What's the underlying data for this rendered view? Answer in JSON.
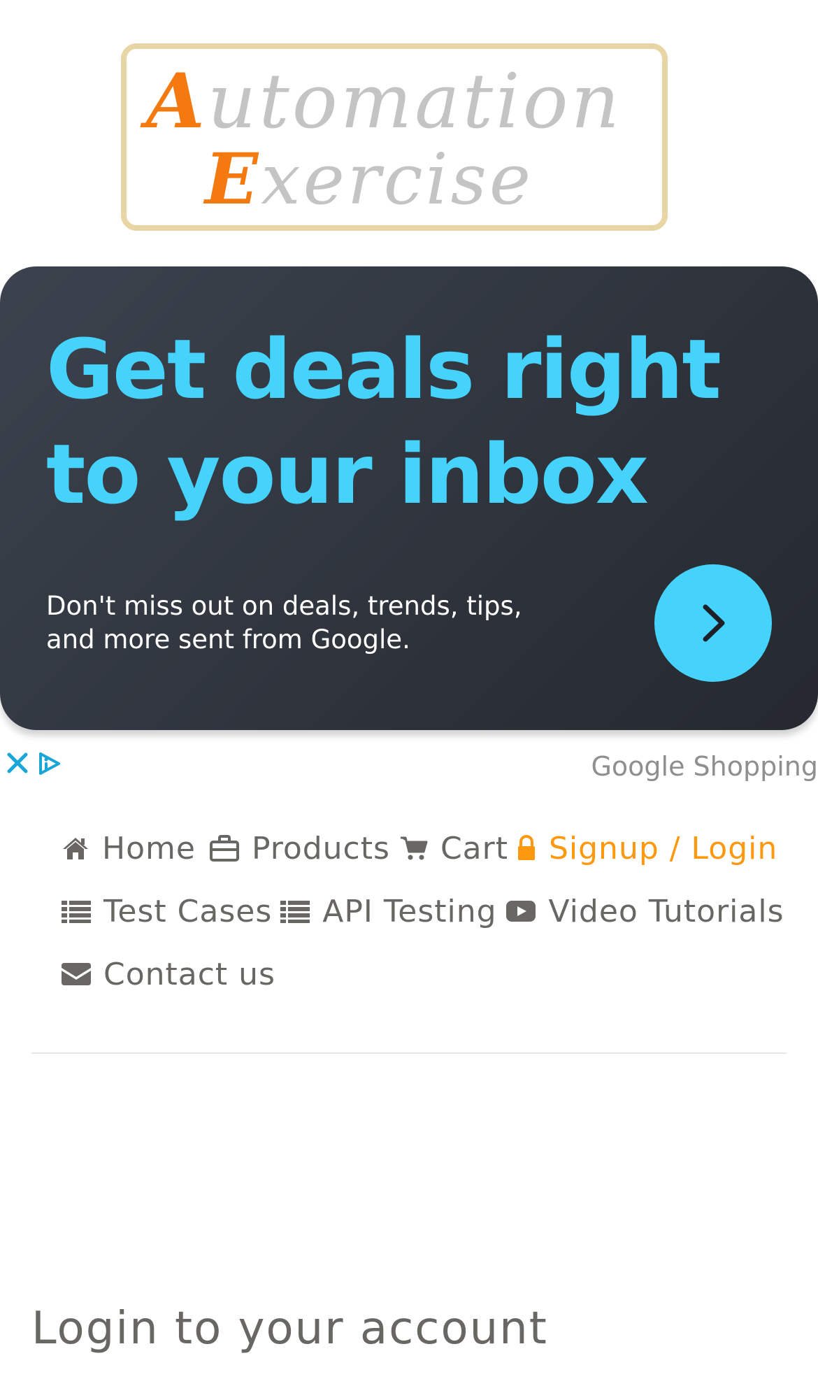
{
  "logo": {
    "line1_cap": "A",
    "line1_rest": "utomation",
    "line2_cap": "E",
    "line2_rest": "xercise"
  },
  "ad": {
    "headline": "Get deals right to your inbox",
    "body": "Don't miss out on deals, trends, tips, and more sent from Google.",
    "arrow_icon": "chevron-right-icon",
    "source": "Google Shopping",
    "close_icon": "close-icon",
    "choices_icon": "adchoices-icon",
    "colors": {
      "accent": "#45d2fb",
      "card": "#2f343d"
    }
  },
  "nav": {
    "items": [
      {
        "label": "Home",
        "icon": "home-icon"
      },
      {
        "label": "Products",
        "icon": "briefcase-icon"
      },
      {
        "label": "Cart",
        "icon": "shopping-cart-icon"
      },
      {
        "label": "Signup / Login",
        "icon": "lock-icon",
        "active": true
      },
      {
        "label": "Test Cases",
        "icon": "list-icon"
      },
      {
        "label": "API Testing",
        "icon": "list-icon"
      },
      {
        "label": "Video Tutorials",
        "icon": "youtube-play-icon"
      },
      {
        "label": "Contact us",
        "icon": "envelope-icon"
      }
    ],
    "colors": {
      "text": "#696763",
      "active": "#fe980f"
    }
  },
  "login": {
    "title": "Login to your account"
  }
}
